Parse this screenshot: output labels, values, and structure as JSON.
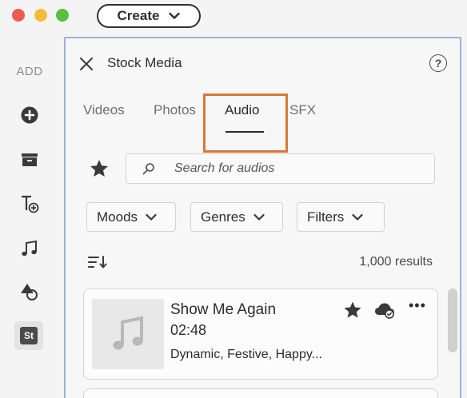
{
  "titlebar": {
    "create_label": "Create"
  },
  "rail": {
    "add_label": "ADD",
    "items": [
      {
        "icon": "plus-circle-icon"
      },
      {
        "icon": "archive-icon"
      },
      {
        "icon": "text-add-icon"
      },
      {
        "icon": "music-note-icon"
      },
      {
        "icon": "shapes-icon"
      },
      {
        "icon": "stock-icon",
        "label": "St"
      }
    ]
  },
  "panel": {
    "title": "Stock Media",
    "help_label": "?",
    "tabs": [
      {
        "label": "Videos"
      },
      {
        "label": "Photos"
      },
      {
        "label": "Audio",
        "active": true
      },
      {
        "label": "SFX"
      }
    ],
    "search": {
      "placeholder": "Search for audios"
    },
    "filters": [
      {
        "label": "Moods"
      },
      {
        "label": "Genres"
      },
      {
        "label": "Filters"
      }
    ],
    "results_count": "1,000 results",
    "items": [
      {
        "title": "Show Me Again",
        "duration": "02:48",
        "tags": "Dynamic, Festive, Happy..."
      }
    ],
    "more_label": "•••"
  },
  "colors": {
    "highlight": "#d9773a",
    "panel_border": "#9eb0d6",
    "traffic_red": "#ee5a52",
    "traffic_yellow": "#f4bb3d",
    "traffic_green": "#56c13e"
  }
}
